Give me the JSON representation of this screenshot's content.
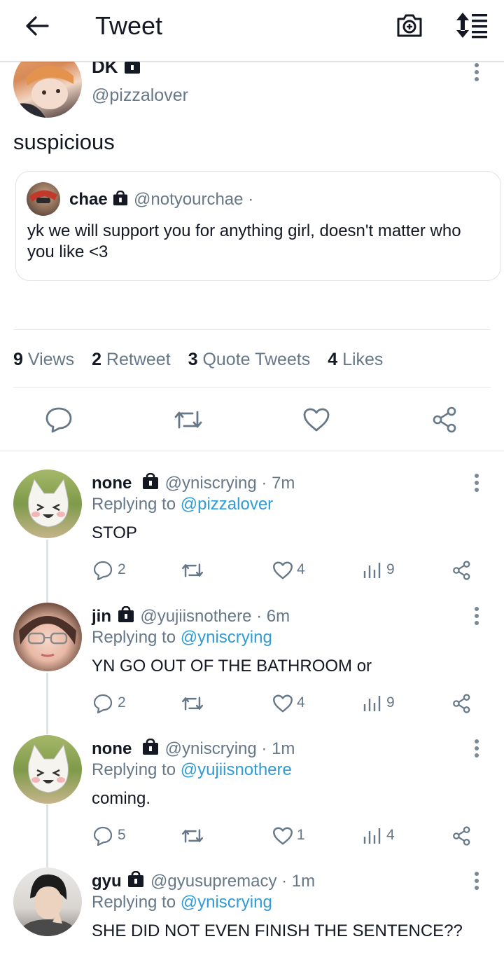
{
  "header": {
    "title": "Tweet",
    "back_icon": "arrow-left-icon",
    "camera_icon": "camera-add-icon",
    "sort_icon": "sort-list-icon"
  },
  "main_tweet": {
    "display_name": "DK",
    "handle": "@pizzalover",
    "text": "suspicious",
    "quoted": {
      "display_name": "chae",
      "handle": "@notyourchae",
      "separator": "·",
      "text": "yk we will support you for anything girl, doesn't matter who you like <3"
    },
    "stats": [
      {
        "count": "9",
        "label": "Views"
      },
      {
        "count": "2",
        "label": "Retweet"
      },
      {
        "count": "3",
        "label": "Quote Tweets"
      },
      {
        "count": "4",
        "label": "Likes"
      }
    ]
  },
  "replies": [
    {
      "display_name": "none",
      "handle": "@yniscrying",
      "time": "· 7m",
      "replying_prefix": "Replying to",
      "replying_to": "@pizzalover",
      "text": "STOP",
      "replies_count": "2",
      "likes_count": "4",
      "views_count": "9"
    },
    {
      "display_name": "jin",
      "handle": "@yujiisnothere",
      "time": "· 6m",
      "replying_prefix": "Replying to",
      "replying_to": "@yniscrying",
      "text": "YN GO OUT OF THE BATHROOM or",
      "replies_count": "2",
      "likes_count": "4",
      "views_count": "9"
    },
    {
      "display_name": "none",
      "handle": "@yniscrying",
      "time": "· 1m",
      "replying_prefix": "Replying to",
      "replying_to": "@yujiisnothere",
      "text": "coming.",
      "replies_count": "5",
      "likes_count": "1",
      "views_count": "4"
    },
    {
      "display_name": "gyu",
      "handle": "@gyusupremacy",
      "time": "· 1m",
      "replying_prefix": "Replying to",
      "replying_to": "@yniscrying",
      "text": "SHE DID NOT EVEN FINISH THE SENTENCE??"
    }
  ],
  "colors": {
    "accent": "#2f9bd8",
    "muted": "#667788",
    "divider": "#e3e7ea"
  }
}
